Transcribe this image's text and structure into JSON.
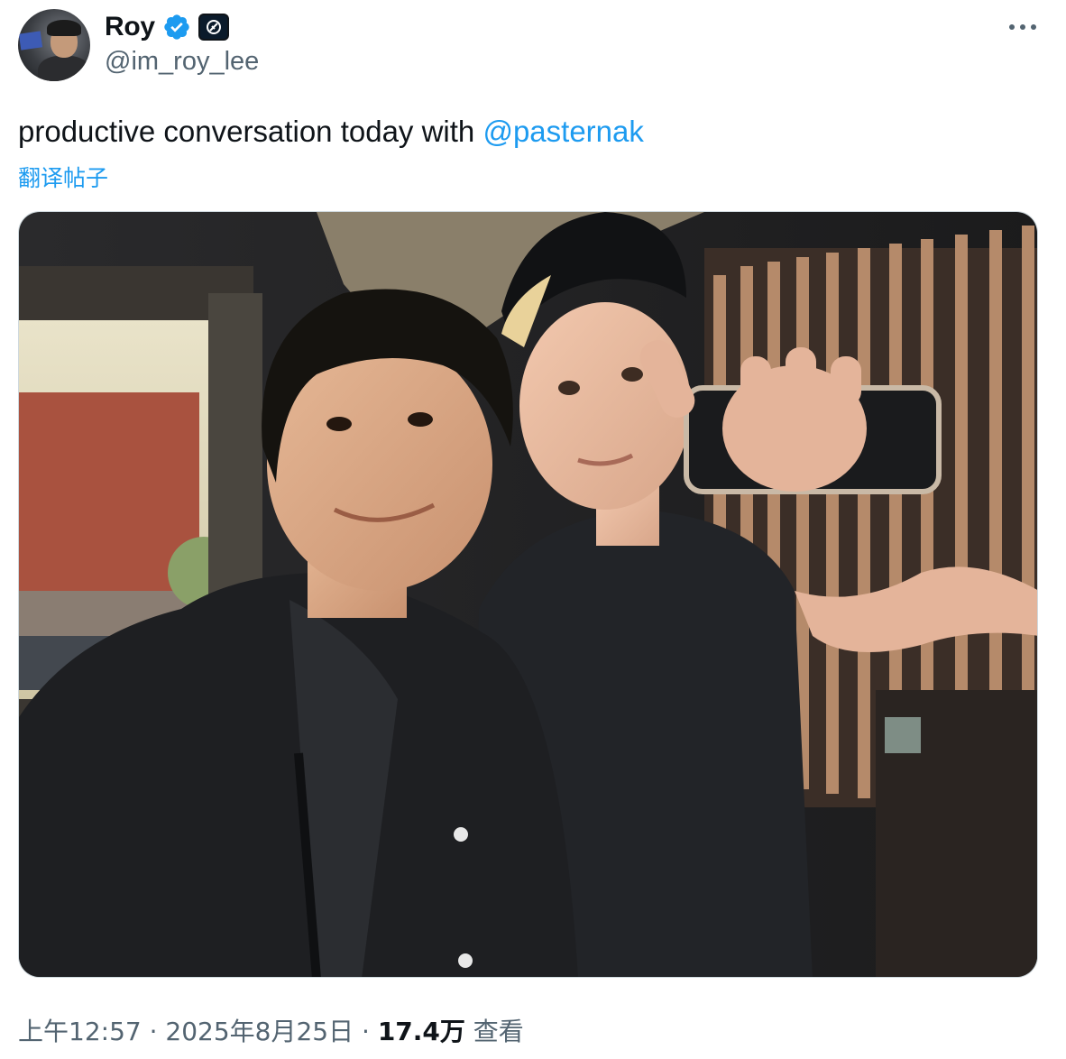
{
  "author": {
    "display_name": "Roy",
    "handle": "@im_roy_lee",
    "avatar_icon": "profile-photo",
    "verified_icon": "verified-badge-icon",
    "affiliate_icon": "affiliate-badge-icon",
    "verified_color": "#1d9bf0"
  },
  "menu": {
    "icon": "more-options-icon"
  },
  "tweet": {
    "text": "productive conversation today with ",
    "mention": "@pasternak",
    "translate_label": "翻译帖子"
  },
  "media": {
    "type": "photo"
  },
  "meta": {
    "time": "上午12:57",
    "separator1": " · ",
    "date": "2025年8月25日",
    "separator2": " · ",
    "views_count": "17.4万",
    "views_label": " 查看"
  },
  "colors": {
    "link": "#1d9bf0",
    "text": "#0f1419",
    "secondary": "#536471"
  }
}
